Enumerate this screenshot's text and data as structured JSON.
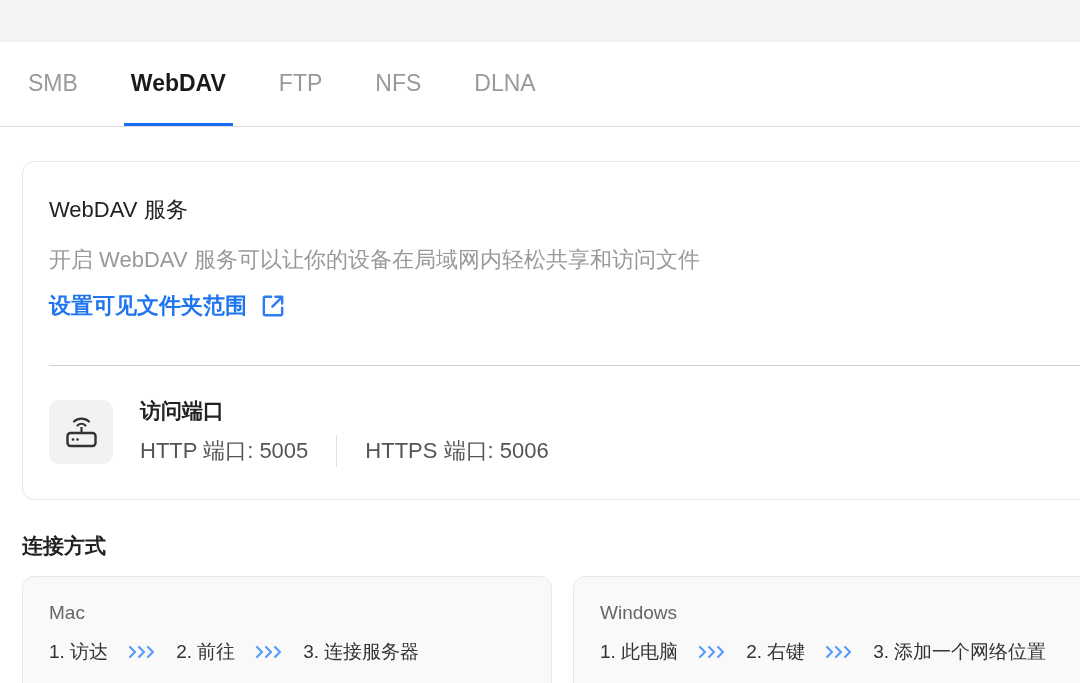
{
  "tabs": [
    {
      "label": "SMB",
      "selected": false
    },
    {
      "label": "WebDAV",
      "selected": true
    },
    {
      "label": "FTP",
      "selected": false
    },
    {
      "label": "NFS",
      "selected": false
    },
    {
      "label": "DLNA",
      "selected": false
    }
  ],
  "service": {
    "title": "WebDAV 服务",
    "description": "开启 WebDAV 服务可以让你的设备在局域网内轻松共享和访问文件",
    "link": "设置可见文件夹范围"
  },
  "ports": {
    "title": "访问端口",
    "items": [
      "HTTP 端口: 5005",
      "HTTPS 端口: 5006"
    ]
  },
  "connection": {
    "title": "连接方式",
    "methods": [
      {
        "platform": "Mac",
        "steps": [
          "1. 访达",
          "2. 前往",
          "3. 连接服务器"
        ]
      },
      {
        "platform": "Windows",
        "steps": [
          "1. 此电脑",
          "2. 右键",
          "3. 添加一个网络位置"
        ]
      }
    ]
  }
}
